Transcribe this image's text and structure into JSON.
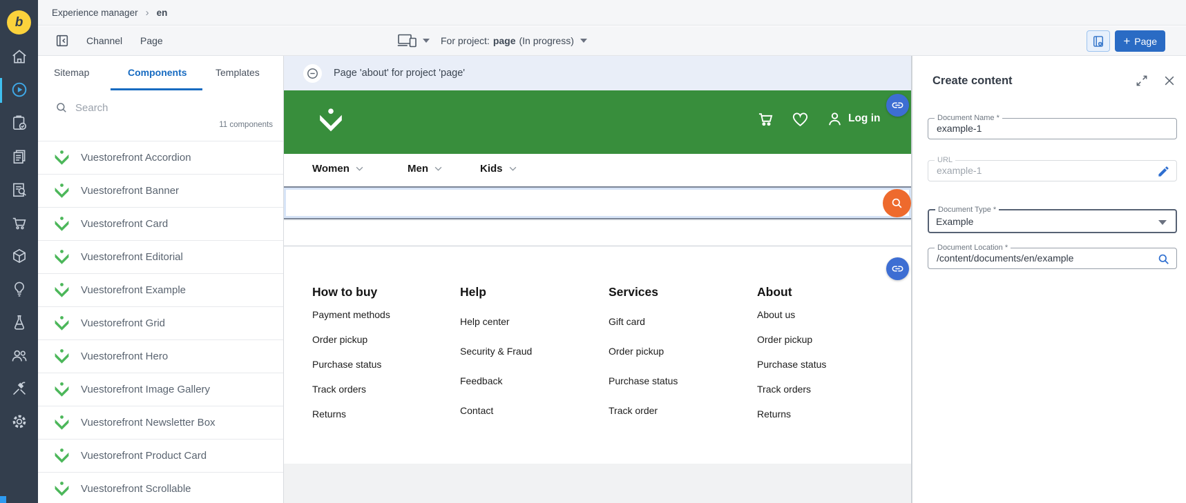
{
  "colors": {
    "sidebar_bg": "#333e4d",
    "logo_yellow": "#fbd23c",
    "active_icon_blue": "#3fa9e8",
    "tab_accent_blue": "#176bc1",
    "button_blue": "#2a6bc4",
    "notice_bg": "#e9eef8",
    "storefront_green": "#388e3c",
    "component_green": "#4cb75a",
    "search_orange": "#ee6a2d",
    "link_fab_blue": "#3d6ed3",
    "field_icon_blue": "#2f6fd0"
  },
  "sidebar": {
    "logo": "b",
    "icons": [
      "home",
      "experience-manager",
      "projects",
      "documents",
      "content-search",
      "commerce",
      "products",
      "insights",
      "experiments",
      "audiences",
      "setup",
      "settings"
    ],
    "active": "experience-manager"
  },
  "breadcrumb": {
    "items": [
      "Experience manager",
      "en"
    ]
  },
  "toolbar": {
    "menus": [
      "Channel",
      "Page"
    ],
    "for_project_label": "For project:",
    "project_name": "page",
    "project_status": "(In progress)",
    "add_page_label": "Page"
  },
  "left_panel": {
    "tabs": [
      "Sitemap",
      "Components",
      "Templates"
    ],
    "active_tab": "Components",
    "search_placeholder": "Search",
    "count_label": "11 components",
    "components": [
      "Vuestorefront Accordion",
      "Vuestorefront Banner",
      "Vuestorefront Card",
      "Vuestorefront Editorial",
      "Vuestorefront Example",
      "Vuestorefront Grid",
      "Vuestorefront Hero",
      "Vuestorefront Image Gallery",
      "Vuestorefront Newsletter Box",
      "Vuestorefront Product Card",
      "Vuestorefront Scrollable"
    ]
  },
  "preview": {
    "notice": "Page 'about' for project 'page'",
    "nav_items": [
      "Women",
      "Men",
      "Kids"
    ],
    "login_label": "Log in",
    "footer": {
      "columns": [
        {
          "title": "How to buy",
          "links": [
            "Payment methods",
            "Order pickup",
            "Purchase status",
            "Track orders",
            "Returns"
          ]
        },
        {
          "title": "Help",
          "links": [
            "Help center",
            "Security & Fraud",
            "Feedback",
            "Contact"
          ]
        },
        {
          "title": "Services",
          "links": [
            "Gift card",
            "Order pickup",
            "Purchase status",
            "Track order"
          ]
        },
        {
          "title": "About",
          "links": [
            "About us",
            "Order pickup",
            "Purchase status",
            "Track orders",
            "Returns"
          ]
        }
      ]
    }
  },
  "create_panel": {
    "title": "Create content",
    "fields": {
      "document_name": {
        "label": "Document Name *",
        "value": "example-1"
      },
      "url": {
        "label": "URL",
        "value": "example-1"
      },
      "document_type": {
        "label": "Document Type *",
        "value": "Example"
      },
      "document_location": {
        "label": "Document Location *",
        "value": "/content/documents/en/example"
      }
    }
  }
}
